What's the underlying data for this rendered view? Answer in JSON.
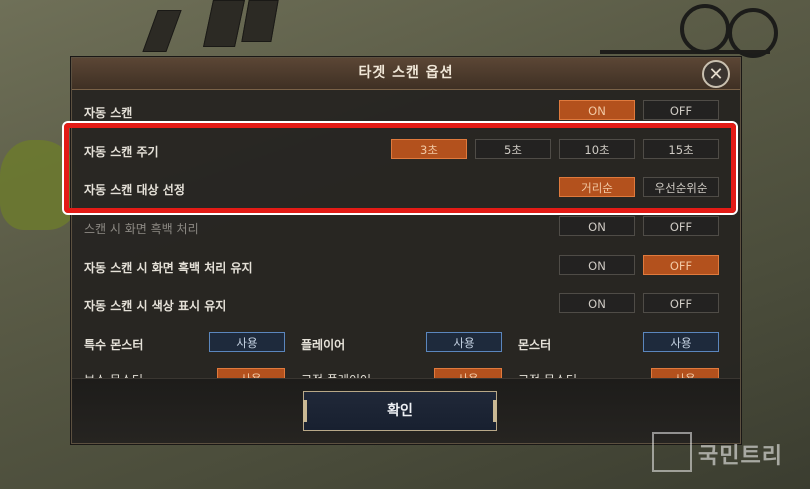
{
  "dialog": {
    "title": "타겟 스캔 옵션",
    "close_icon": "close-x-icon"
  },
  "rows": [
    {
      "label": "자동 스캔",
      "options": [
        "ON",
        "OFF"
      ],
      "selected": "ON"
    },
    {
      "label": "자동 스캔 주기",
      "options": [
        "3초",
        "5초",
        "10초",
        "15초"
      ],
      "selected": "3초"
    },
    {
      "label": "자동 스캔 대상 선정",
      "options": [
        "거리순",
        "우선순위순"
      ],
      "selected": "거리순"
    },
    {
      "label": "스캔 시 화면 흑백 처리",
      "options": [
        "ON",
        "OFF"
      ],
      "selected": ""
    },
    {
      "label": "자동 스캔 시 화면 흑백 처리 유지",
      "options": [
        "ON",
        "OFF"
      ],
      "selected": "OFF"
    },
    {
      "label": "자동 스캔 시 색상 표시 유지",
      "options": [
        "ON",
        "OFF"
      ],
      "selected": ""
    }
  ],
  "categories": [
    {
      "label": "특수 몬스터",
      "button": "사용"
    },
    {
      "label": "플레이어",
      "button": "사용"
    },
    {
      "label": "몬스터",
      "button": "사용"
    }
  ],
  "partial_row": [
    {
      "label": "보스 몬스터",
      "button": "사용"
    },
    {
      "label": "고정 플레이어",
      "button": "사용"
    },
    {
      "label": "고정 몬스터",
      "button": "사용"
    }
  ],
  "footer": {
    "confirm_label": "확인"
  },
  "watermark": {
    "text": "국민트리"
  },
  "colors": {
    "accent_orange": "#b3511d",
    "accent_blue": "#5b86bd",
    "highlight_red": "#e31b16",
    "title_bar": "#4f3c2d"
  }
}
